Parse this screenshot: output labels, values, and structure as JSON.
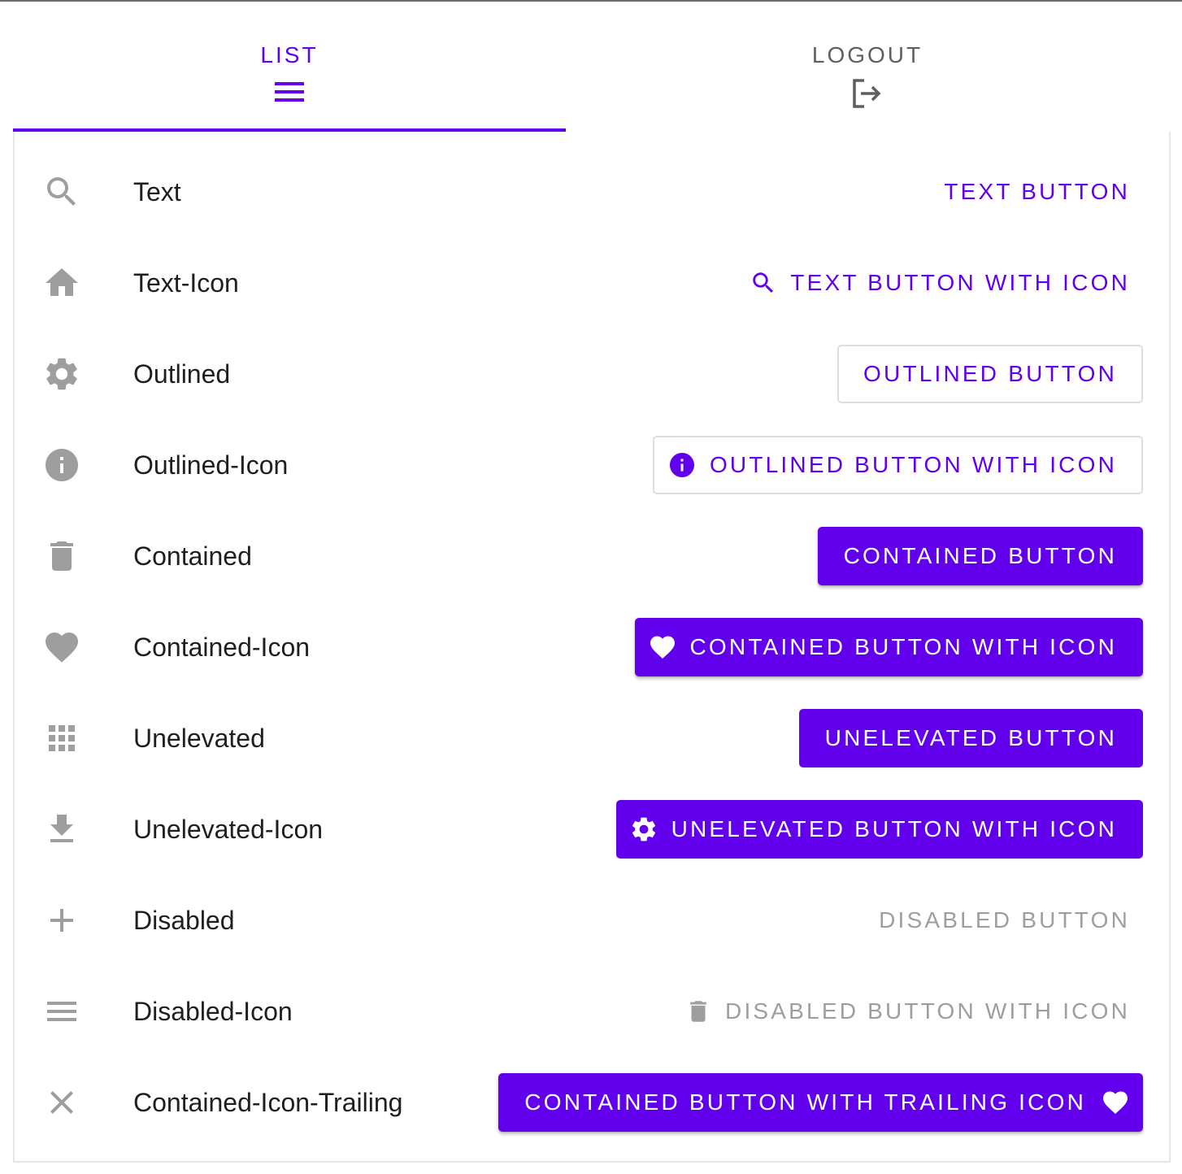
{
  "tabs": [
    {
      "label": "LIST",
      "icon": "menu-icon",
      "active": true
    },
    {
      "label": "LOGOUT",
      "icon": "logout-icon",
      "active": false
    }
  ],
  "colors": {
    "primary": "#6200ee",
    "icon_gray": "#9e9e9e",
    "disabled_text": "#9e9e9e",
    "text": "#1f1f1f"
  },
  "rows": [
    {
      "label": "Text",
      "icon": "search-icon",
      "button": {
        "variant": "text",
        "label": "TEXT BUTTON"
      }
    },
    {
      "label": "Text-Icon",
      "icon": "home-icon",
      "button": {
        "variant": "text",
        "label": "TEXT BUTTON WITH ICON",
        "leading_icon": "search-icon"
      }
    },
    {
      "label": "Outlined",
      "icon": "gear-icon",
      "button": {
        "variant": "outlined",
        "label": "OUTLINED BUTTON"
      }
    },
    {
      "label": "Outlined-Icon",
      "icon": "info-icon",
      "button": {
        "variant": "outlined",
        "label": "OUTLINED BUTTON WITH ICON",
        "leading_icon": "info-icon"
      }
    },
    {
      "label": "Contained",
      "icon": "trash-icon",
      "button": {
        "variant": "contained",
        "label": "CONTAINED BUTTON"
      }
    },
    {
      "label": "Contained-Icon",
      "icon": "heart-icon",
      "button": {
        "variant": "contained",
        "label": "CONTAINED BUTTON WITH ICON",
        "leading_icon": "heart-icon"
      }
    },
    {
      "label": "Unelevated",
      "icon": "apps-grid-icon",
      "button": {
        "variant": "unelevated",
        "label": "UNELEVATED BUTTON"
      }
    },
    {
      "label": "Unelevated-Icon",
      "icon": "download-icon",
      "button": {
        "variant": "unelevated",
        "label": "UNELEVATED BUTTON WITH ICON",
        "leading_icon": "gear-icon"
      }
    },
    {
      "label": "Disabled",
      "icon": "plus-icon",
      "button": {
        "variant": "disabled",
        "label": "DISABLED BUTTON"
      }
    },
    {
      "label": "Disabled-Icon",
      "icon": "menu-icon",
      "button": {
        "variant": "disabled",
        "label": "DISABLED BUTTON WITH ICON",
        "leading_icon": "trash-icon"
      }
    },
    {
      "label": "Contained-Icon-Trailing",
      "icon": "close-icon",
      "button": {
        "variant": "contained",
        "label": "CONTAINED BUTTON WITH TRAILING ICON",
        "trailing_icon": "heart-icon"
      }
    }
  ]
}
